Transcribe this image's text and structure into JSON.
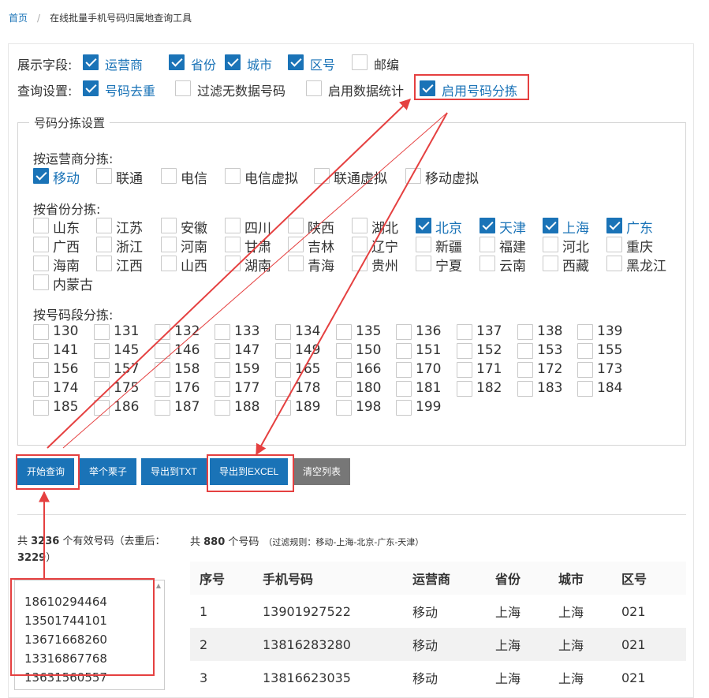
{
  "breadcrumb": {
    "home": "首页",
    "sep": "/",
    "current": "在线批量手机号码归属地查询工具"
  },
  "display": {
    "label": "展示字段:",
    "options": [
      {
        "label": "运营商",
        "checked": true
      },
      {
        "label": "省份",
        "checked": true
      },
      {
        "label": "城市",
        "checked": true
      },
      {
        "label": "区号",
        "checked": true
      },
      {
        "label": "邮编",
        "checked": false
      }
    ]
  },
  "query": {
    "label": "查询设置:",
    "options": [
      {
        "label": "号码去重",
        "checked": true
      },
      {
        "label": "过滤无数据号码",
        "checked": false
      },
      {
        "label": "启用数据统计",
        "checked": false
      },
      {
        "label": "启用号码分拣",
        "checked": true
      }
    ]
  },
  "sort": {
    "legend": "号码分拣设置",
    "carrier_title": "按运营商分拣:",
    "carriers": [
      {
        "label": "移动",
        "checked": true
      },
      {
        "label": "联通",
        "checked": false
      },
      {
        "label": "电信",
        "checked": false
      },
      {
        "label": "电信虚拟",
        "checked": false
      },
      {
        "label": "联通虚拟",
        "checked": false
      },
      {
        "label": "移动虚拟",
        "checked": false
      }
    ],
    "province_title": "按省份分拣:",
    "provinces": [
      {
        "label": "山东",
        "checked": false
      },
      {
        "label": "江苏",
        "checked": false
      },
      {
        "label": "安徽",
        "checked": false
      },
      {
        "label": "四川",
        "checked": false
      },
      {
        "label": "陕西",
        "checked": false
      },
      {
        "label": "湖北",
        "checked": false
      },
      {
        "label": "北京",
        "checked": true
      },
      {
        "label": "天津",
        "checked": true
      },
      {
        "label": "上海",
        "checked": true
      },
      {
        "label": "广东",
        "checked": true
      },
      {
        "label": "广西",
        "checked": false
      },
      {
        "label": "浙江",
        "checked": false
      },
      {
        "label": "河南",
        "checked": false
      },
      {
        "label": "甘肃",
        "checked": false
      },
      {
        "label": "吉林",
        "checked": false
      },
      {
        "label": "辽宁",
        "checked": false
      },
      {
        "label": "新疆",
        "checked": false
      },
      {
        "label": "福建",
        "checked": false
      },
      {
        "label": "河北",
        "checked": false
      },
      {
        "label": "重庆",
        "checked": false
      },
      {
        "label": "海南",
        "checked": false
      },
      {
        "label": "江西",
        "checked": false
      },
      {
        "label": "山西",
        "checked": false
      },
      {
        "label": "湖南",
        "checked": false
      },
      {
        "label": "青海",
        "checked": false
      },
      {
        "label": "贵州",
        "checked": false
      },
      {
        "label": "宁夏",
        "checked": false
      },
      {
        "label": "云南",
        "checked": false
      },
      {
        "label": "西藏",
        "checked": false
      },
      {
        "label": "黑龙江",
        "checked": false
      },
      {
        "label": "内蒙古",
        "checked": false
      }
    ],
    "prefix_title": "按号码段分拣:",
    "prefixes": [
      "130",
      "131",
      "132",
      "133",
      "134",
      "135",
      "136",
      "137",
      "138",
      "139",
      "141",
      "145",
      "146",
      "147",
      "149",
      "150",
      "151",
      "152",
      "153",
      "155",
      "156",
      "157",
      "158",
      "159",
      "165",
      "166",
      "170",
      "171",
      "172",
      "173",
      "174",
      "175",
      "176",
      "177",
      "178",
      "180",
      "181",
      "182",
      "183",
      "184",
      "185",
      "186",
      "187",
      "188",
      "189",
      "198",
      "199"
    ]
  },
  "buttons": {
    "start": "开始查询",
    "example": "举个栗子",
    "export_txt": "导出到TXT",
    "export_excel": "导出到EXCEL",
    "clear": "清空列表"
  },
  "stats_left": {
    "prefix": "共 ",
    "count": "3236",
    "middle": " 个有效号码（去重后：",
    "dedup": "3229",
    "suffix": "）"
  },
  "stats_right": {
    "prefix": "共 ",
    "count": "880",
    "suffix": " 个号码",
    "rule": "（过滤规则：移动-上海-北京-广东-天津）"
  },
  "numbers": [
    "18610294464",
    "13501744101",
    "13671668260",
    "13316867768",
    "13631560557"
  ],
  "table": {
    "headers": [
      "序号",
      "手机号码",
      "运营商",
      "省份",
      "城市",
      "区号"
    ],
    "rows": [
      [
        "1",
        "13901927522",
        "移动",
        "上海",
        "上海",
        "021"
      ],
      [
        "2",
        "13816283280",
        "移动",
        "上海",
        "上海",
        "021"
      ],
      [
        "3",
        "13816623035",
        "移动",
        "上海",
        "上海",
        "021"
      ]
    ]
  },
  "colors": {
    "accent": "#1a73b7",
    "highlight": "#e54040",
    "gray_button": "#777777"
  }
}
